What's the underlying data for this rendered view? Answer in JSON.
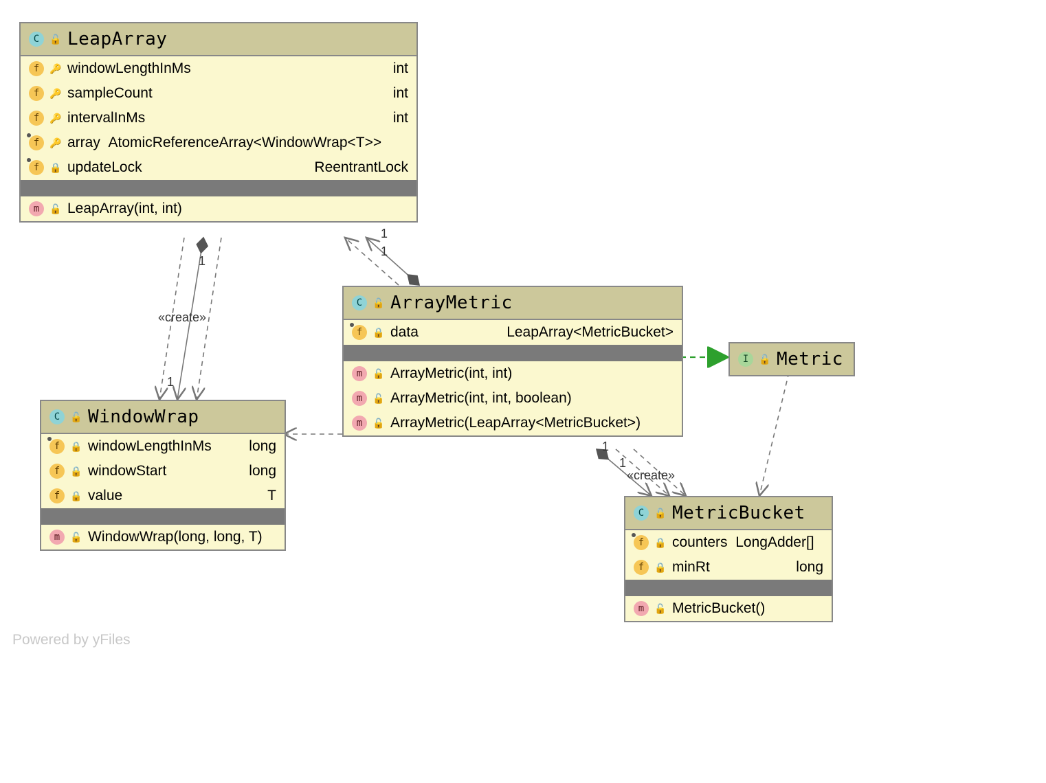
{
  "footer": "Powered by yFiles",
  "relations": [
    {
      "from": "LeapArray",
      "to": "WindowWrap",
      "kind": "composition",
      "mult_from": "1",
      "mult_to": "1"
    },
    {
      "from": "LeapArray",
      "to": "WindowWrap",
      "kind": "create-dependency",
      "label": "«create»"
    },
    {
      "from": "ArrayMetric",
      "to": "LeapArray",
      "kind": "composition",
      "mult_from": "1",
      "mult_to": "1"
    },
    {
      "from": "ArrayMetric",
      "to": "WindowWrap",
      "kind": "dependency"
    },
    {
      "from": "ArrayMetric",
      "to": "Metric",
      "kind": "realization"
    },
    {
      "from": "ArrayMetric",
      "to": "MetricBucket",
      "kind": "composition",
      "mult_from": "1",
      "mult_to": "1"
    },
    {
      "from": "ArrayMetric",
      "to": "MetricBucket",
      "kind": "create-dependency",
      "label": "«create»"
    },
    {
      "from": "Metric",
      "to": "MetricBucket",
      "kind": "dependency"
    }
  ],
  "classes": {
    "LeapArray": {
      "name": "LeapArray",
      "stereotype": "class",
      "fields": [
        {
          "name": "windowLengthInMs",
          "type": "int",
          "vis": "protected",
          "inherited": false
        },
        {
          "name": "sampleCount",
          "type": "int",
          "vis": "protected",
          "inherited": false
        },
        {
          "name": "intervalInMs",
          "type": "int",
          "vis": "protected",
          "inherited": false
        },
        {
          "name": "array",
          "type": "AtomicReferenceArray<WindowWrap<T>>",
          "vis": "protected",
          "inherited": true,
          "inline": true
        },
        {
          "name": "updateLock",
          "type": "ReentrantLock",
          "vis": "private",
          "inherited": true
        }
      ],
      "methods": [
        {
          "sig": "LeapArray(int, int)",
          "vis": "public"
        }
      ]
    },
    "ArrayMetric": {
      "name": "ArrayMetric",
      "stereotype": "class",
      "fields": [
        {
          "name": "data",
          "type": "LeapArray<MetricBucket>",
          "vis": "private",
          "inherited": true
        }
      ],
      "methods": [
        {
          "sig": "ArrayMetric(int, int)",
          "vis": "public"
        },
        {
          "sig": "ArrayMetric(int, int, boolean)",
          "vis": "public"
        },
        {
          "sig": "ArrayMetric(LeapArray<MetricBucket>)",
          "vis": "public"
        }
      ]
    },
    "WindowWrap": {
      "name": "WindowWrap",
      "stereotype": "class",
      "fields": [
        {
          "name": "windowLengthInMs",
          "type": "long",
          "vis": "private",
          "inherited": true
        },
        {
          "name": "windowStart",
          "type": "long",
          "vis": "private",
          "inherited": false
        },
        {
          "name": "value",
          "type": "T",
          "vis": "private",
          "inherited": false
        }
      ],
      "methods": [
        {
          "sig": "WindowWrap(long, long, T)",
          "vis": "public"
        }
      ]
    },
    "MetricBucket": {
      "name": "MetricBucket",
      "stereotype": "class",
      "fields": [
        {
          "name": "counters",
          "type": "LongAdder[]",
          "vis": "private",
          "inherited": true,
          "inline": true
        },
        {
          "name": "minRt",
          "type": "long",
          "vis": "private",
          "inherited": false
        }
      ],
      "methods": [
        {
          "sig": "MetricBucket()",
          "vis": "public"
        }
      ]
    },
    "Metric": {
      "name": "Metric",
      "stereotype": "interface"
    }
  },
  "labels": {
    "create1": "«create»",
    "create2": "«create»"
  },
  "mults": {
    "one": "1"
  }
}
